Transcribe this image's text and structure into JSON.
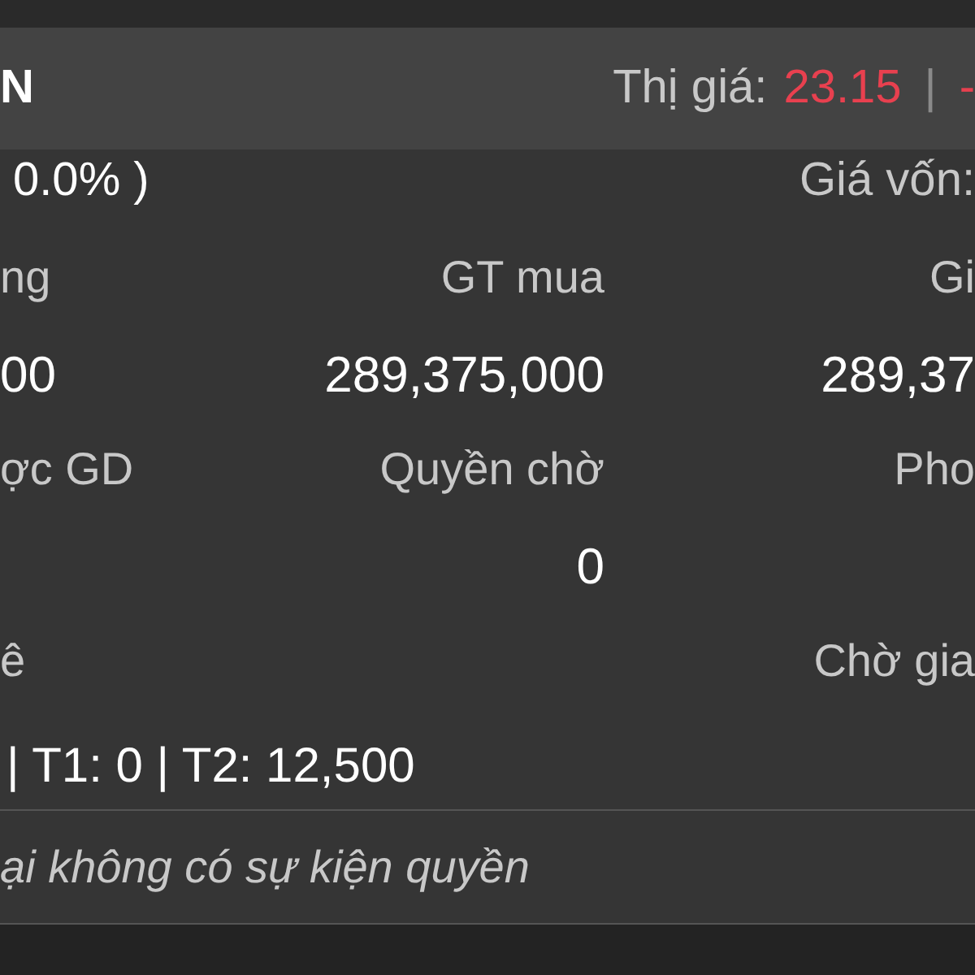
{
  "header": {
    "title": "N",
    "market_price_label": "Thị giá:",
    "market_price": "23.15",
    "separator": "|",
    "change": "-"
  },
  "subheader": {
    "change_percent": "0.0% )",
    "cost_price_label": "Giá vốn:"
  },
  "rows": [
    {
      "kind": "label",
      "column_1": "ng",
      "column_2": "GT mua",
      "column_3": "Gi"
    },
    {
      "kind": "value",
      "column_1": "00",
      "column_2": "289,375,000",
      "column_3": "289,37"
    },
    {
      "kind": "label",
      "column_1": "ợc GD",
      "column_2": "Quyền chờ",
      "column_3": "Pho"
    },
    {
      "kind": "value",
      "column_2": "0"
    },
    {
      "kind": "label",
      "column_1": "ê",
      "column_3": "Chờ gia"
    }
  ],
  "settlement": "| T1: 0 | T2: 12,500",
  "rights_note": "ại không có sự kiện quyền"
}
